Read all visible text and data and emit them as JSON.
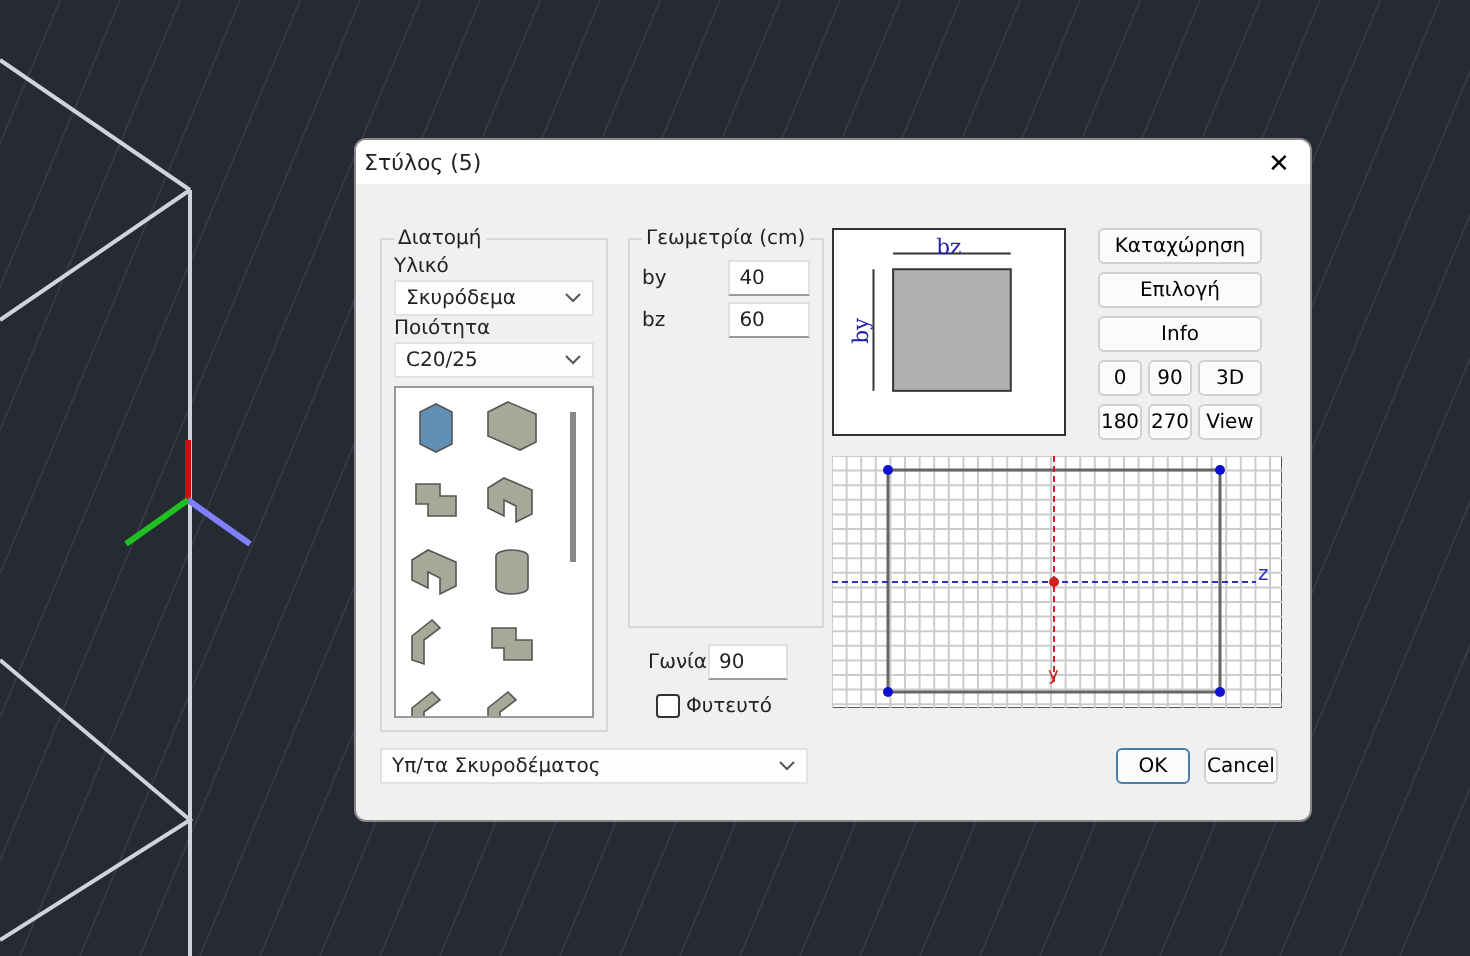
{
  "window": {
    "title": "Στύλος (5)",
    "close": "✕"
  },
  "section_group": {
    "title": "Διατομή",
    "material_label": "Υλικό",
    "material": "Σκυρόδεμα",
    "quality_label": "Ποιότητα",
    "quality": "C20/25",
    "shapes": [
      {
        "kind": "box",
        "selected": true
      },
      {
        "kind": "lblock",
        "selected": false
      },
      {
        "kind": "tee",
        "selected": false
      },
      {
        "kind": "channel",
        "selected": false
      },
      {
        "kind": "channel",
        "selected": false
      },
      {
        "kind": "cylinder",
        "selected": false
      },
      {
        "kind": "angle",
        "selected": false
      },
      {
        "kind": "tee",
        "selected": false
      },
      {
        "kind": "angle",
        "selected": false
      },
      {
        "kind": "angle",
        "selected": false
      }
    ]
  },
  "geometry_group": {
    "title": "Γεωμετρία (cm)",
    "fields": [
      {
        "label": "by",
        "value": "40"
      },
      {
        "label": "bz",
        "value": "60"
      }
    ]
  },
  "angle": {
    "label": "Γωνία",
    "value": "90"
  },
  "planted": {
    "label": "Φυτευτό",
    "checked": false
  },
  "preview": {
    "bz": "bz",
    "by": "by"
  },
  "buttons": [
    "Καταχώρηση",
    "Επιλογή",
    "Info"
  ],
  "view_buttons": [
    "0",
    "90",
    "3D",
    "180",
    "270",
    "View"
  ],
  "grid_axes": {
    "z": "z",
    "y": "y"
  },
  "bottom_select": "Υπ/τα Σκυροδέματος",
  "dialog_buttons": [
    {
      "label": "OK",
      "default": true
    },
    {
      "label": "Cancel",
      "default": false
    }
  ]
}
